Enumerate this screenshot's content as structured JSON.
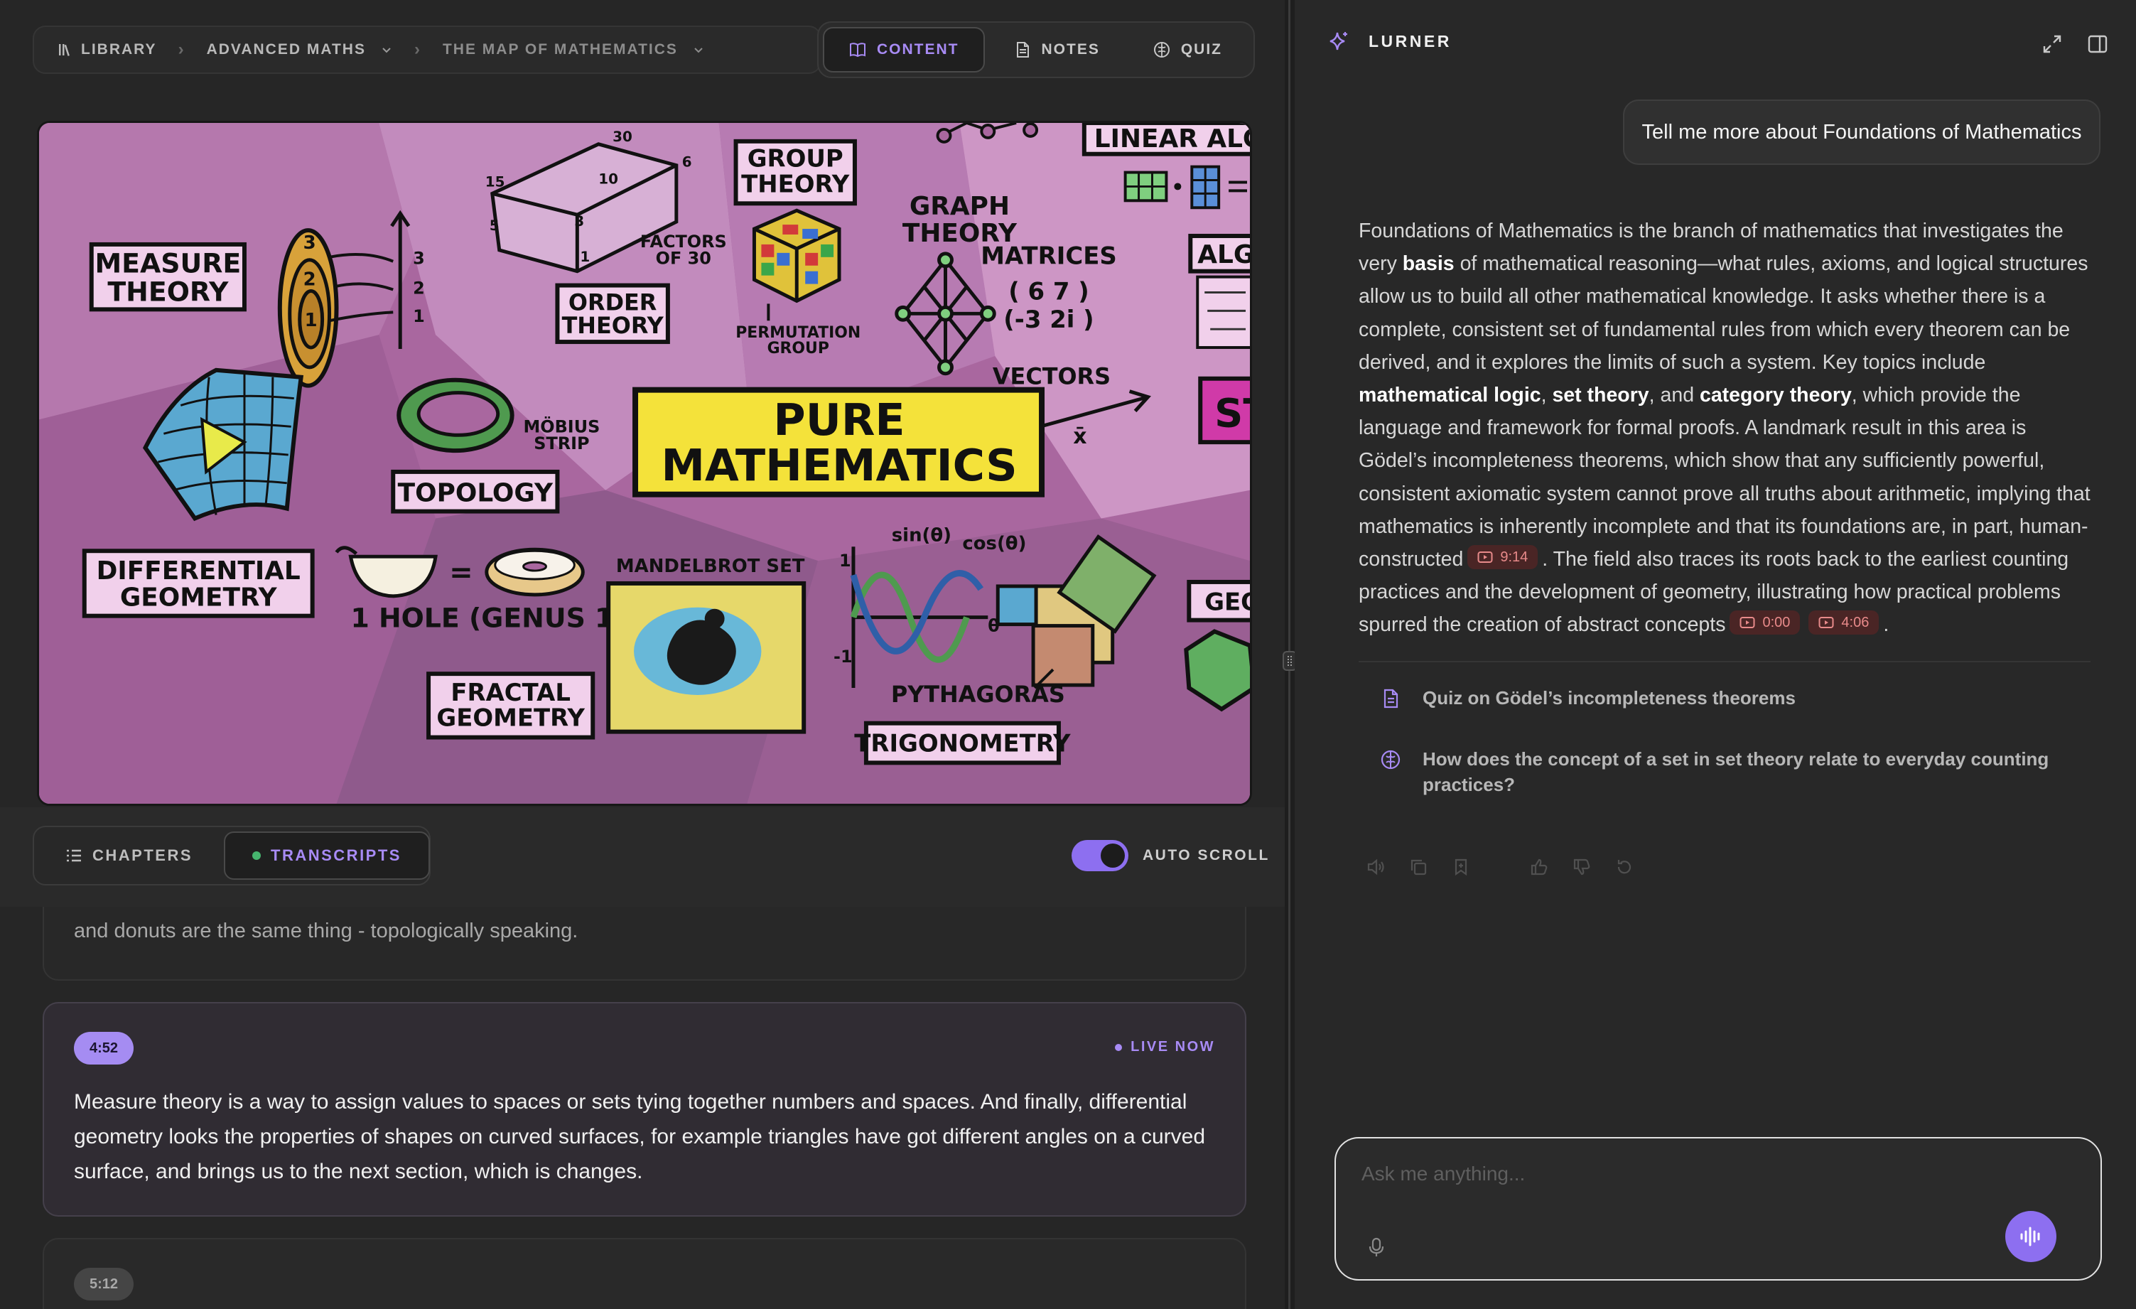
{
  "breadcrumb": {
    "library": "LIBRARY",
    "course": "ADVANCED MATHS",
    "lesson": "THE MAP OF MATHEMATICS"
  },
  "view_tabs": {
    "content": "CONTENT",
    "notes": "NOTES",
    "quiz": "QUIZ",
    "active": "content"
  },
  "video": {
    "labels": {
      "measure": [
        "MEASURE",
        "THEORY"
      ],
      "group": [
        "GROUP",
        "THEORY"
      ],
      "graph": [
        "GRAPH",
        "THEORY"
      ],
      "order": [
        "ORDER",
        "THEORY"
      ],
      "factors": [
        "FACTORS",
        "OF 30"
      ],
      "permutation": [
        "PERMUTATION",
        "GROUP"
      ],
      "linear": "LINEAR ALG",
      "alg": "ALG",
      "matrices": "MATRICES",
      "matrix": [
        "( 6  7 )",
        "(-3  2i )"
      ],
      "vectors": "VECTORS",
      "vec_x": "x̄",
      "pure": [
        "PURE",
        "MATHEMATICS"
      ],
      "topology": "TOPOLOGY",
      "mobius": [
        "MÖBIUS",
        "STRIP"
      ],
      "differential": [
        "DIFFERENTIAL",
        "GEOMETRY"
      ],
      "genus": "1 HOLE (GENUS 1)",
      "mandelbrot": "MANDELBROT SET",
      "fractal": [
        "FRACTAL",
        "GEOMETRY"
      ],
      "sin": "sin(θ)",
      "cos": "cos(θ)",
      "theta": "θ",
      "one": "1",
      "neg_one": "-1",
      "pythagoras": "PYTHAGORAS",
      "trigonometry": "TRIGONOMETRY",
      "geo": "GEO",
      "st": "ST",
      "cube_nums": [
        "30",
        "15",
        "10",
        "6",
        "5",
        "3",
        "1"
      ],
      "ring_nums": [
        "3",
        "2",
        "1"
      ],
      "axis_nums": [
        "3",
        "2",
        "1"
      ],
      "equals": "="
    }
  },
  "sub_tabs": {
    "chapters": "CHAPTERS",
    "transcripts": "TRANSCRIPTS"
  },
  "autoscroll": {
    "label": "AUTO SCROLL",
    "on": true
  },
  "transcripts": [
    {
      "text": "and donuts are the same thing - topologically speaking."
    },
    {
      "time": "4:52",
      "status": "LIVE NOW",
      "text": "Measure theory is a way to assign values to spaces or sets tying together numbers and spaces. And finally, differential geometry looks the properties of shapes on curved surfaces, for example triangles have got different angles on a curved surface, and brings us to the next section, which is changes."
    },
    {
      "time": "5:12"
    }
  ],
  "assistant": {
    "name": "LURNER",
    "user_message": "Tell me more about Foundations of Mathematics",
    "answer": {
      "p1": "Foundations of Mathematics is the branch of mathematics that investigates the very ",
      "b1": "basis",
      "p2": " of mathematical reasoning—what rules, axioms, and logical structures allow us to build all other mathematical knowledge. It asks whether there is a complete, consistent set of fundamental rules from which every theorem can be derived, and it explores the limits of such a system. Key topics include ",
      "b2": "mathematical logic",
      "p3": ", ",
      "b3": "set theory",
      "p4": ", and ",
      "b4": "category theory",
      "p5": ", which provide the language and framework for formal proofs. A landmark result in this area is Gödel’s incompleteness theorems, which show that any sufficiently powerful, consistent axiomatic system cannot prove all truths about arithmetic, implying that mathematics is inherently incomplete and that its foundations are, in part, human-constructed",
      "ref1": "9:14",
      "p6": ". The field also traces its roots back to the earliest counting practices and the development of geometry, illustrating how practical problems spurred the creation of abstract concepts",
      "ref2": "0:00",
      "ref3": "4:06",
      "p7": "."
    },
    "suggestions": [
      {
        "icon": "document-icon",
        "text": "Quiz on Gödel’s incompleteness theorems"
      },
      {
        "icon": "brain-icon",
        "text": "How does the concept of a set in set theory relate to everyday counting practices?"
      }
    ],
    "input_placeholder": "Ask me anything..."
  },
  "colors": {
    "accent": "#a88bf5",
    "accent_fill": "#8d6ff0",
    "live_green": "#46b46e",
    "ref_red": "#e88a8a"
  }
}
